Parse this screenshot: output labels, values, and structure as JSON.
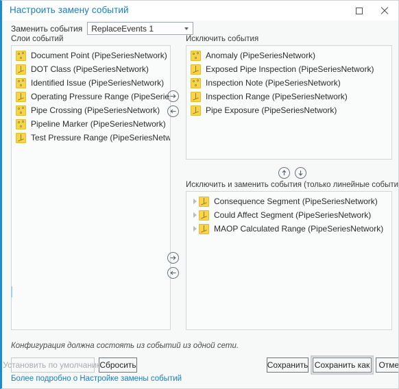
{
  "window": {
    "title": "Настроить замену событий",
    "maximize_icon": "maximize-icon",
    "close_icon": "close-icon"
  },
  "replace_row": {
    "label": "Заменить события",
    "combo_value": "ReplaceEvents 1",
    "combo_arrow_icon": "chevron-down-icon"
  },
  "left_panel": {
    "label": "Слои событий",
    "items": [
      {
        "name": "Document Point (PipeSeriesNetwork)",
        "icon": "point-layer-icon"
      },
      {
        "name": "DOT Class (PipeSeriesNetwork)",
        "icon": "line-layer-icon"
      },
      {
        "name": "Identified Issue (PipeSeriesNetwork)",
        "icon": "point-layer-icon"
      },
      {
        "name": "Operating Pressure Range (PipeSeriesNetwork)",
        "icon": "line-layer-icon"
      },
      {
        "name": "Pipe Crossing (PipeSeriesNetwork)",
        "icon": "point-layer-icon"
      },
      {
        "name": "Pipeline Marker (PipeSeriesNetwork)",
        "icon": "point-layer-icon"
      },
      {
        "name": "Test Pressure Range (PipeSeriesNetwork)",
        "icon": "line-layer-icon"
      }
    ]
  },
  "exclude_panel": {
    "label": "Исключить события",
    "items": [
      {
        "name": "Anomaly (PipeSeriesNetwork)",
        "icon": "point-layer-icon"
      },
      {
        "name": "Exposed Pipe Inspection (PipeSeriesNetwork)",
        "icon": "line-layer-icon"
      },
      {
        "name": "Inspection Note (PipeSeriesNetwork)",
        "icon": "point-layer-icon"
      },
      {
        "name": "Inspection Range (PipeSeriesNetwork)",
        "icon": "line-layer-icon"
      },
      {
        "name": "Pipe Exposure (PipeSeriesNetwork)",
        "icon": "line-layer-icon"
      }
    ]
  },
  "exclude_replace_panel": {
    "label": "Исключить и заменить события (только линейные события)",
    "items": [
      {
        "name": "Consequence Segment (PipeSeriesNetwork)",
        "icon": "line-layer-icon",
        "expander": "chevron-right-icon"
      },
      {
        "name": "Could Affect Segment (PipeSeriesNetwork)",
        "icon": "line-layer-icon",
        "expander": "chevron-right-icon"
      },
      {
        "name": "MAOP Calculated Range (PipeSeriesNetwork)",
        "icon": "line-layer-icon",
        "expander": "chevron-right-icon"
      }
    ]
  },
  "transfer_top": {
    "add_icon": "arrow-right-circle-icon",
    "remove_icon": "arrow-left-circle-icon"
  },
  "transfer_bottom": {
    "add_icon": "arrow-right-circle-icon",
    "remove_icon": "arrow-left-circle-icon"
  },
  "reorder": {
    "up_icon": "arrow-up-circle-icon",
    "down_icon": "arrow-down-circle-icon"
  },
  "footer": {
    "note": "Конфигурация должна состоять из событий из одной сети.",
    "set_default_label": "Установить по умолчанию",
    "reset_label": "Сбросить",
    "save_label": "Сохранить",
    "save_as_label": "Сохранить как",
    "cancel_label": "Отмена",
    "help_link": "Более подробно о Настройке замены событий"
  },
  "colors": {
    "accent": "#1580c4",
    "layer_icon": "#f7d44c",
    "panel_bg": "#f7f8f8",
    "list_bg": "#fafbfb"
  }
}
